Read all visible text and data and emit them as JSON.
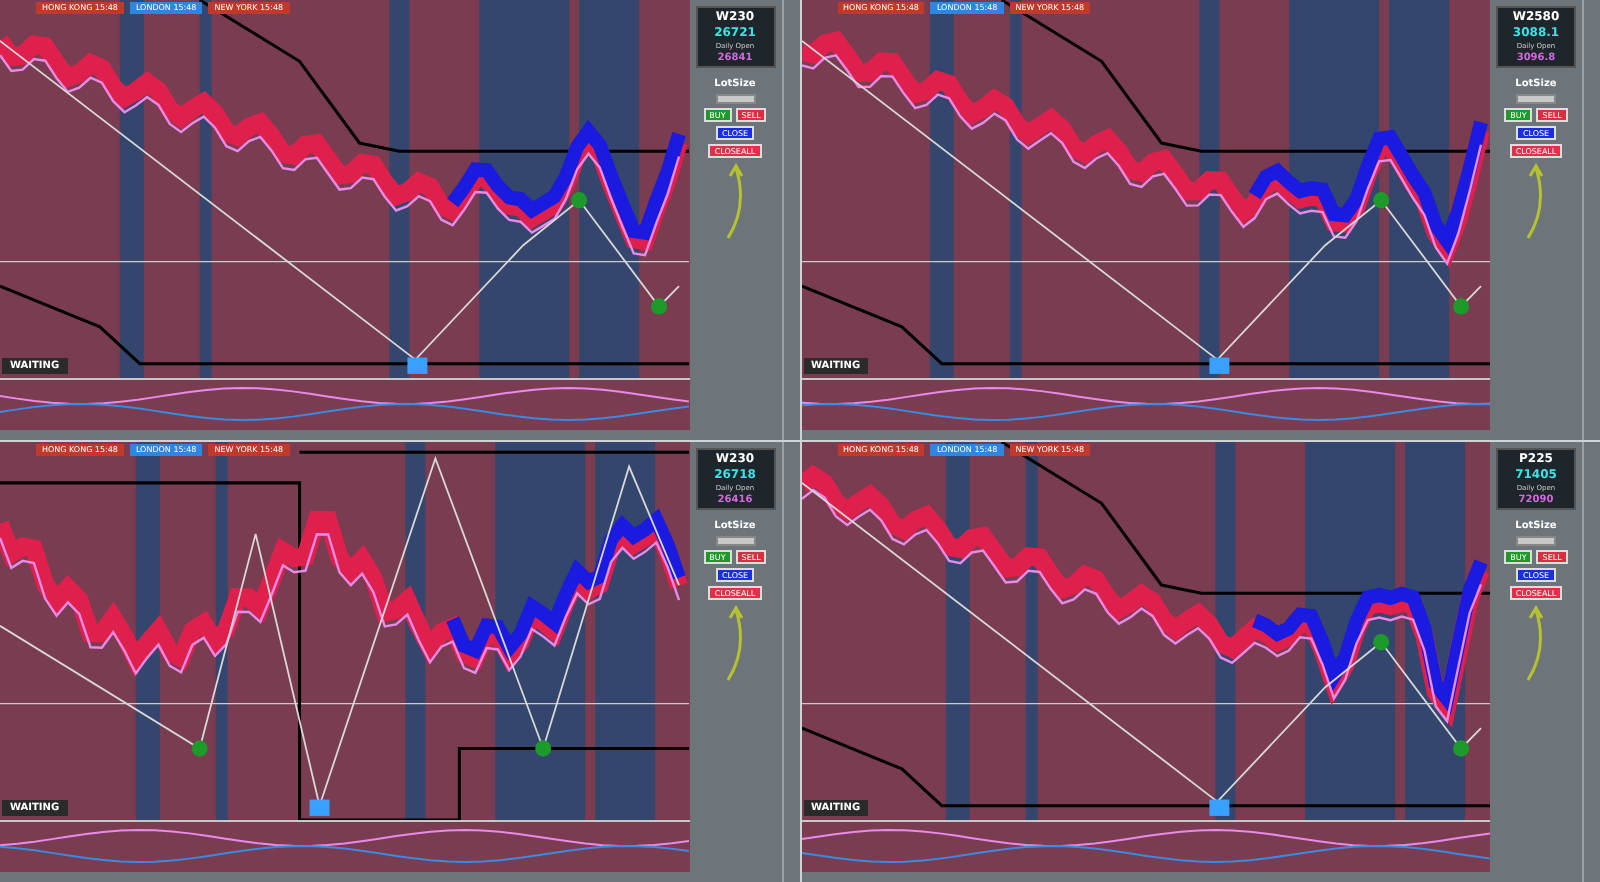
{
  "panels": [
    {
      "sessions": [
        {
          "label": "HONG KONG 15:48",
          "color": "#c0392b"
        },
        {
          "label": "LONDON 15:48",
          "color": "#2e86de"
        },
        {
          "label": "NEW YORK 15:48",
          "color": "#c0392b"
        }
      ],
      "info": {
        "symbol": "W230",
        "price": "26721",
        "daily_open_label": "Daily Open",
        "daily_open": "26841"
      },
      "lot_size_label": "LotSize",
      "buttons": [
        {
          "label": "BUY",
          "kind": "buy"
        },
        {
          "label": "SELL",
          "kind": "sell"
        },
        {
          "label": "CLOSE",
          "kind": "close"
        },
        {
          "label": "CLOSEALL",
          "kind": "closeall"
        }
      ],
      "status": "WAITING"
    },
    {
      "sessions": [
        {
          "label": "HONG KONG 15:48",
          "color": "#c0392b"
        },
        {
          "label": "LONDON 15:48",
          "color": "#2e86de"
        },
        {
          "label": "NEW YORK 15:48",
          "color": "#c0392b"
        }
      ],
      "info": {
        "symbol": "W2580",
        "price": "3088.1",
        "daily_open_label": "Daily Open",
        "daily_open": "3096.8"
      },
      "lot_size_label": "LotSize",
      "buttons": [
        {
          "label": "BUY",
          "kind": "buy"
        },
        {
          "label": "SELL",
          "kind": "sell"
        },
        {
          "label": "CLOSE",
          "kind": "close"
        },
        {
          "label": "CLOSEALL",
          "kind": "closeall"
        }
      ],
      "status": "WAITING"
    },
    {
      "sessions": [
        {
          "label": "HONG KONG 15:48",
          "color": "#c0392b"
        },
        {
          "label": "LONDON 15:48",
          "color": "#2e86de"
        },
        {
          "label": "NEW YORK 15:48",
          "color": "#c0392b"
        }
      ],
      "info": {
        "symbol": "W230",
        "price": "26718",
        "daily_open_label": "Daily Open",
        "daily_open": "26416"
      },
      "lot_size_label": "LotSize",
      "buttons": [
        {
          "label": "BUY",
          "kind": "buy"
        },
        {
          "label": "SELL",
          "kind": "sell"
        },
        {
          "label": "CLOSE",
          "kind": "close"
        },
        {
          "label": "CLOSEALL",
          "kind": "closeall"
        }
      ],
      "status": "WAITING"
    },
    {
      "sessions": [
        {
          "label": "HONG KONG 15:48",
          "color": "#c0392b"
        },
        {
          "label": "LONDON 15:48",
          "color": "#2e86de"
        },
        {
          "label": "NEW YORK 15:48",
          "color": "#c0392b"
        }
      ],
      "info": {
        "symbol": "P225",
        "price": "71405",
        "daily_open_label": "Daily Open",
        "daily_open": "72090"
      },
      "lot_size_label": "LotSize",
      "buttons": [
        {
          "label": "BUY",
          "kind": "buy"
        },
        {
          "label": "SELL",
          "kind": "sell"
        },
        {
          "label": "CLOSE",
          "kind": "close"
        },
        {
          "label": "CLOSEALL",
          "kind": "closeall"
        }
      ],
      "status": "WAITING"
    }
  ]
}
